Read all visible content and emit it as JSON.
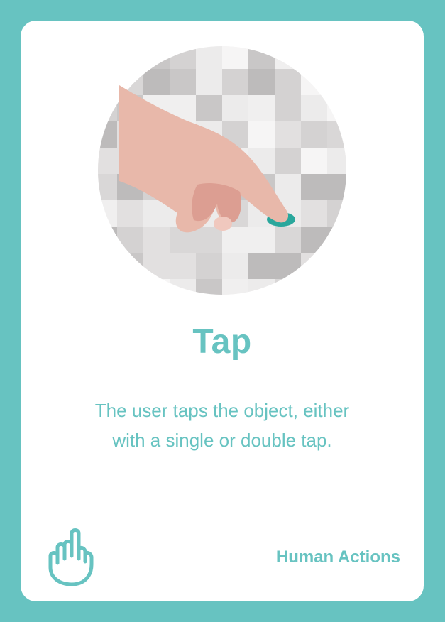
{
  "card": {
    "title": "Tap",
    "description_line1": "The user taps the object, either",
    "description_line2": "with a single or double tap.",
    "category": "Human Actions"
  },
  "colors": {
    "background": "#67c3c1",
    "card": "#ffffff",
    "accent": "#67c3c1",
    "skin": "#e8b8aa",
    "skin_shadow": "#dc9e92",
    "tap_dot": "#2aa79c"
  },
  "icons": {
    "illustration": "hand-tapping-illustration",
    "footer": "tap-hand-icon"
  }
}
